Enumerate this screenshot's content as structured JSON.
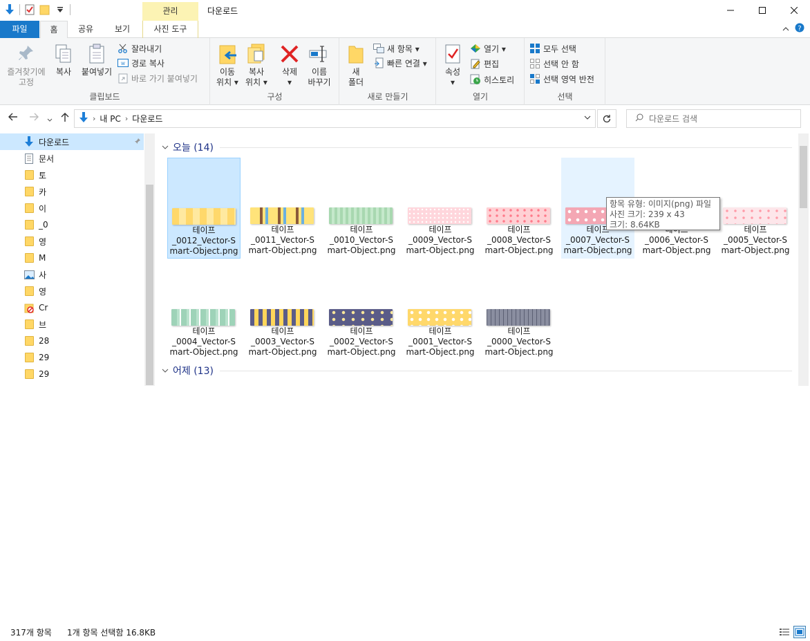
{
  "window": {
    "title": "다운로드",
    "context_tab": "관리"
  },
  "ribbon_tabs": {
    "file": "파일",
    "home": "홈",
    "share": "공유",
    "view": "보기",
    "picture_tools": "사진 도구"
  },
  "ribbon": {
    "clipboard": {
      "label": "클립보드",
      "pin_line1": "즐겨찾기에",
      "pin_line2": "고정",
      "copy": "복사",
      "paste": "붙여넣기",
      "cut": "잘라내기",
      "copy_path": "경로 복사",
      "paste_shortcut": "바로 가기 붙여넣기"
    },
    "organize": {
      "label": "구성",
      "move_line1": "이동",
      "move_line2": "위치 ▾",
      "copyto_line1": "복사",
      "copyto_line2": "위치 ▾",
      "delete_line1": "삭제",
      "delete_line2": "▾",
      "rename_line1": "이름",
      "rename_line2": "바꾸기"
    },
    "new": {
      "label": "새로 만들기",
      "folder_line1": "새",
      "folder_line2": "폴더",
      "new_item": "새 항목 ▾",
      "easy_access": "빠른 연결 ▾"
    },
    "open": {
      "label": "열기",
      "properties_line1": "속성",
      "properties_line2": "▾",
      "open": "열기 ▾",
      "edit": "편집",
      "history": "히스토리"
    },
    "select": {
      "label": "선택",
      "select_all": "모두 선택",
      "select_none": "선택 안 함",
      "invert": "선택 영역 반전"
    }
  },
  "address": {
    "crumb_pc": "내 PC",
    "crumb_folder": "다운로드",
    "search_placeholder": "다운로드 검색"
  },
  "nav_pane": [
    {
      "label": "다운로드",
      "icon": "download-arrow-icon",
      "selected": true,
      "pinned": true
    },
    {
      "label": "문서",
      "icon": "document-icon"
    },
    {
      "label": "토",
      "icon": "folder-icon"
    },
    {
      "label": "카",
      "icon": "folder-icon"
    },
    {
      "label": "이",
      "icon": "folder-icon"
    },
    {
      "label": "_0",
      "icon": "folder-icon"
    },
    {
      "label": "영",
      "icon": "folder-icon"
    },
    {
      "label": "M",
      "icon": "folder-icon"
    },
    {
      "label": "사",
      "icon": "pictures-icon"
    },
    {
      "label": "영",
      "icon": "folder-icon"
    },
    {
      "label": "Cr",
      "icon": "blocked-folder-icon"
    },
    {
      "label": "브",
      "icon": "folder-icon"
    },
    {
      "label": "28",
      "icon": "folder-icon"
    },
    {
      "label": "29",
      "icon": "folder-icon"
    },
    {
      "label": "29",
      "icon": "folder-icon"
    }
  ],
  "groups": [
    {
      "label": "오늘 (14)"
    },
    {
      "label": "어제 (13)"
    }
  ],
  "files": [
    {
      "line1": "테이프",
      "line2": "_0012_Vector-S",
      "line3": "mart-Object.png",
      "pattern": "stars-yellow",
      "state": "selected"
    },
    {
      "line1": "테이프",
      "line2": "_0011_Vector-S",
      "line3": "mart-Object.png",
      "pattern": "dogs-yellow"
    },
    {
      "line1": "테이프",
      "line2": "_0010_Vector-S",
      "line3": "mart-Object.png",
      "pattern": "grid-green"
    },
    {
      "line1": "테이프",
      "line2": "_0009_Vector-S",
      "line3": "mart-Object.png",
      "pattern": "dots-pink"
    },
    {
      "line1": "테이프",
      "line2": "_0008_Vector-S",
      "line3": "mart-Object.png",
      "pattern": "hearts-pink"
    },
    {
      "line1": "테이프",
      "line2": "_0007_Vector-S",
      "line3": "mart-Object.png",
      "pattern": "hearts-rose",
      "state": "hover"
    },
    {
      "line1": "테이프",
      "line2": "_0006_Vector-S",
      "line3": "mart-Object.png",
      "pattern": "hidden"
    },
    {
      "line1": "테이프",
      "line2": "_0005_Vector-S",
      "line3": "mart-Object.png",
      "pattern": "hearts-light"
    },
    {
      "line1": "테이프",
      "line2": "_0004_Vector-S",
      "line3": "mart-Object.png",
      "pattern": "birds-mint"
    },
    {
      "line1": "테이프",
      "line2": "_0003_Vector-S",
      "line3": "mart-Object.png",
      "pattern": "chicks-navy"
    },
    {
      "line1": "테이프",
      "line2": "_0002_Vector-S",
      "line3": "mart-Object.png",
      "pattern": "moon-navy"
    },
    {
      "line1": "테이프",
      "line2": "_0001_Vector-S",
      "line3": "mart-Object.png",
      "pattern": "flowers-yellow"
    },
    {
      "line1": "테이프",
      "line2": "_0000_Vector-S",
      "line3": "mart-Object.png",
      "pattern": "grid-gray"
    }
  ],
  "tooltip": {
    "line1": "항목 유형: 이미지(png) 파일",
    "line2": "사진 크기: 239 x 43",
    "line3": "크기: 8.64KB"
  },
  "status": {
    "count": "317개 항목",
    "selection": "1개 항목 선택함 16.8KB"
  },
  "colors": {
    "accent": "#1979ca",
    "context_tab": "#fcf3b4",
    "selection": "#cce8ff",
    "group_header": "#1e3287"
  }
}
